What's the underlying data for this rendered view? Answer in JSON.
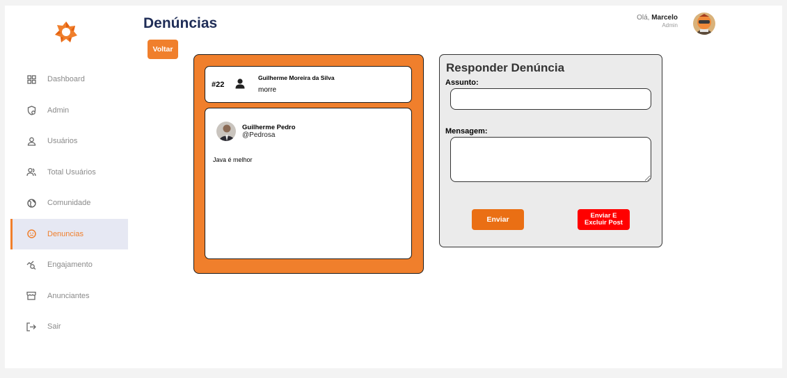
{
  "header": {
    "title": "Denúncias",
    "back_label": "Voltar",
    "greeting_prefix": "Olá,",
    "user_name": "Marcelo",
    "user_role": "Admin"
  },
  "sidebar": {
    "items": [
      {
        "label": "Dashboard",
        "icon": "dashboard-icon"
      },
      {
        "label": "Admin",
        "icon": "admin-shield-icon"
      },
      {
        "label": "Usuários",
        "icon": "user-icon"
      },
      {
        "label": "Total Usuários",
        "icon": "users-icon"
      },
      {
        "label": "Comunidade",
        "icon": "globe-icon"
      },
      {
        "label": "Denuncias",
        "icon": "report-face-icon",
        "active": true
      },
      {
        "label": "Engajamento",
        "icon": "engagement-chart-icon"
      },
      {
        "label": "Anunciantes",
        "icon": "store-icon"
      },
      {
        "label": "Sair",
        "icon": "logout-icon"
      }
    ]
  },
  "report": {
    "id": "#22",
    "reporter": "Guilherme Moreira da Silva",
    "reason": "morre",
    "post": {
      "author": "Guilherme Pedro",
      "handle": "@Pedrosa",
      "text": "Java é melhor"
    }
  },
  "reply_form": {
    "title": "Responder Denúncia",
    "subject_label": "Assunto:",
    "subject_value": "",
    "message_label": "Mensagem:",
    "message_value": "",
    "send_label": "Enviar",
    "send_delete_label": "Enviar E Excluir Post"
  },
  "colors": {
    "accent": "#f07f2c",
    "danger": "#ff0000",
    "title": "#1f2d57"
  }
}
